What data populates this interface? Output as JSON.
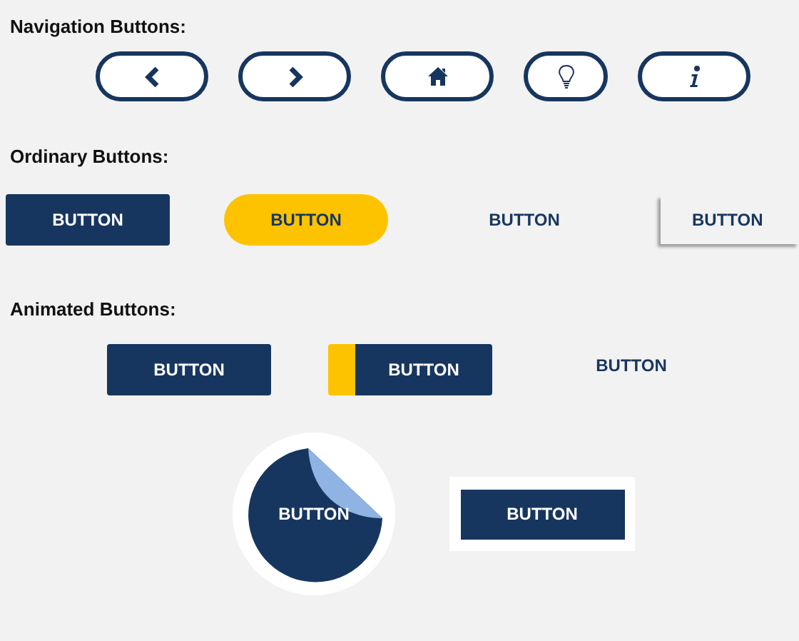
{
  "sections": [
    {
      "title": "Navigation Buttons:",
      "rows": [
        [
          {
            "kind": "chevron-left"
          },
          {
            "kind": "chevron-right"
          },
          {
            "kind": "home"
          },
          {
            "kind": "bulb"
          },
          {
            "kind": "info"
          }
        ]
      ]
    },
    {
      "title": "Ordinary Buttons:",
      "rows": [
        [
          {
            "kind": "solid",
            "label": "BUTTON"
          },
          {
            "kind": "pill",
            "label": "BUTTON"
          },
          {
            "kind": "text",
            "label": "BUTTON"
          },
          {
            "kind": "shadow",
            "label": "BUTTON"
          }
        ]
      ]
    },
    {
      "title": "Animated Buttons:",
      "rows": [
        [
          {
            "kind": "solid",
            "label": "BUTTON"
          },
          {
            "kind": "accent",
            "label": "BUTTON"
          },
          {
            "kind": "text",
            "label": "BUTTON"
          }
        ],
        [
          {
            "kind": "sticker",
            "label": "BUTTON"
          },
          {
            "kind": "framed",
            "label": "BUTTON"
          }
        ]
      ]
    }
  ]
}
